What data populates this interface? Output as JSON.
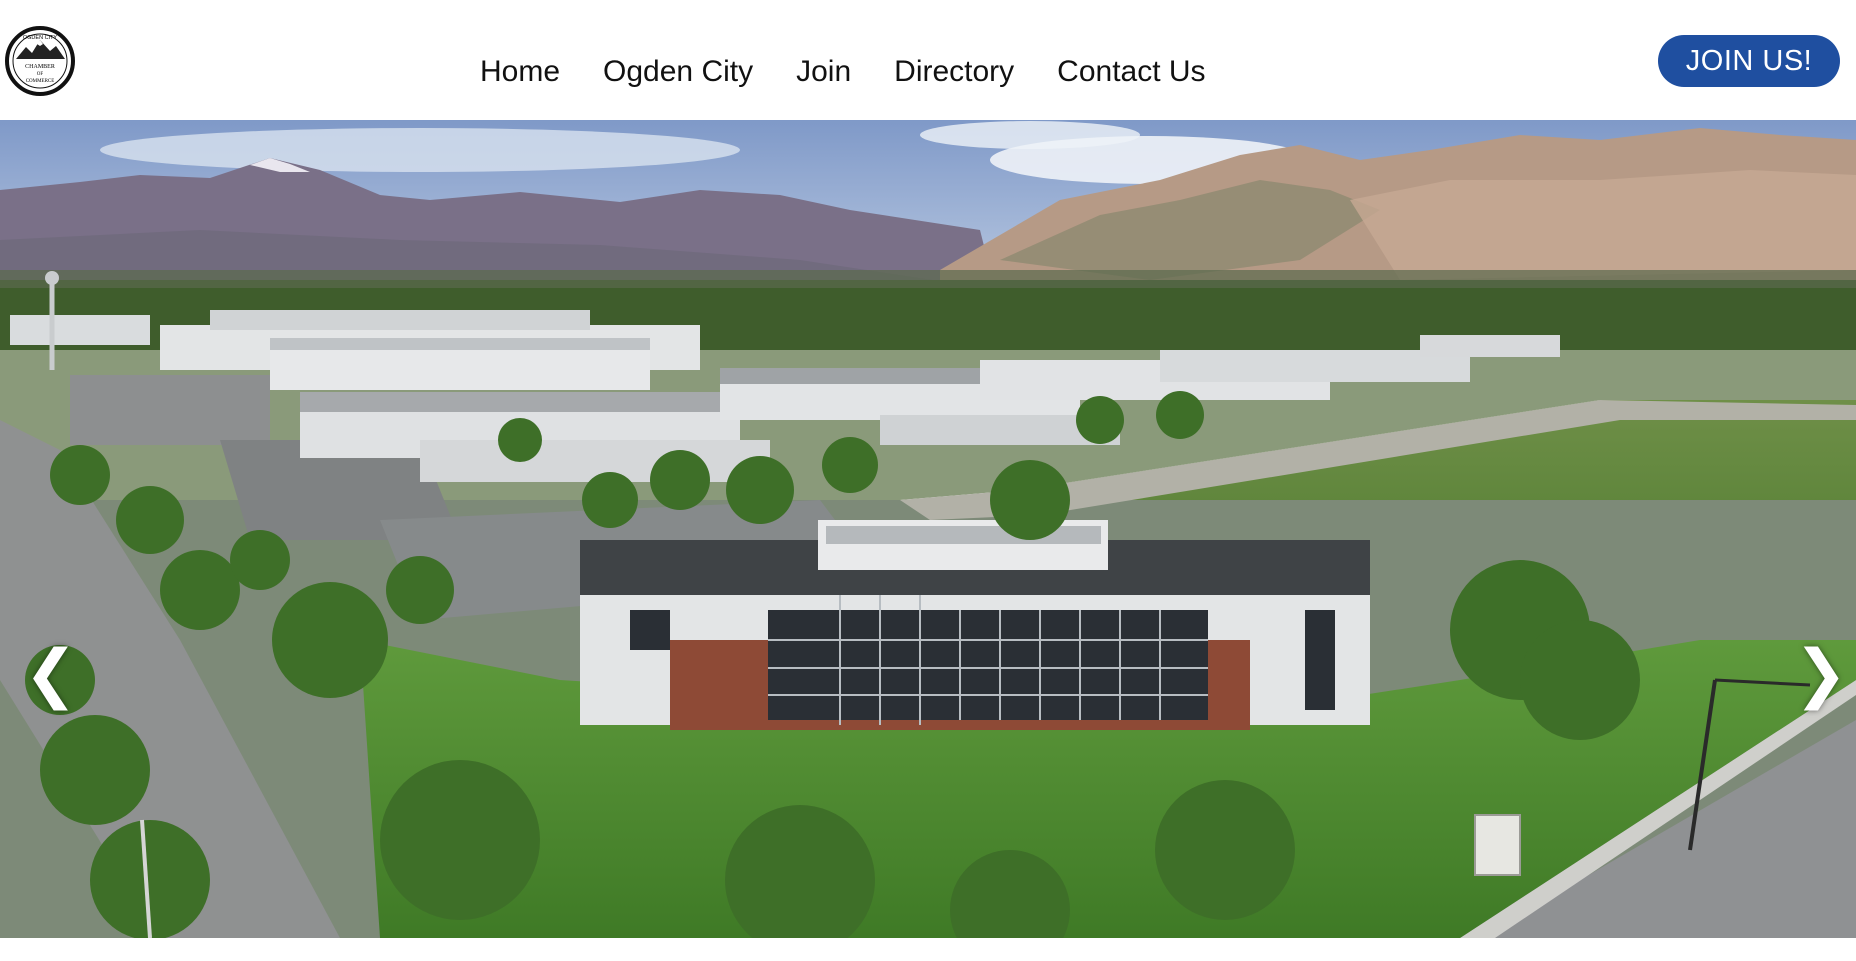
{
  "header": {
    "logo": {
      "icon": "mountain-logo-icon",
      "text_lines": [
        "OGDEN CITY",
        "CHAMBER",
        "OF",
        "COMMERCE"
      ]
    },
    "nav": [
      {
        "label": "Home"
      },
      {
        "label": "Ogden City"
      },
      {
        "label": "Join"
      },
      {
        "label": "Directory"
      },
      {
        "label": "Contact Us"
      }
    ],
    "cta_label": "JOIN US!"
  },
  "hero": {
    "image_subject": "aerial-business-park-mountains",
    "prev_glyph": "❮",
    "next_glyph": "❯"
  },
  "colors": {
    "brand_blue": "#1f4fa0",
    "sky": "#9fb6d6",
    "grass": "#5d8c3a"
  }
}
